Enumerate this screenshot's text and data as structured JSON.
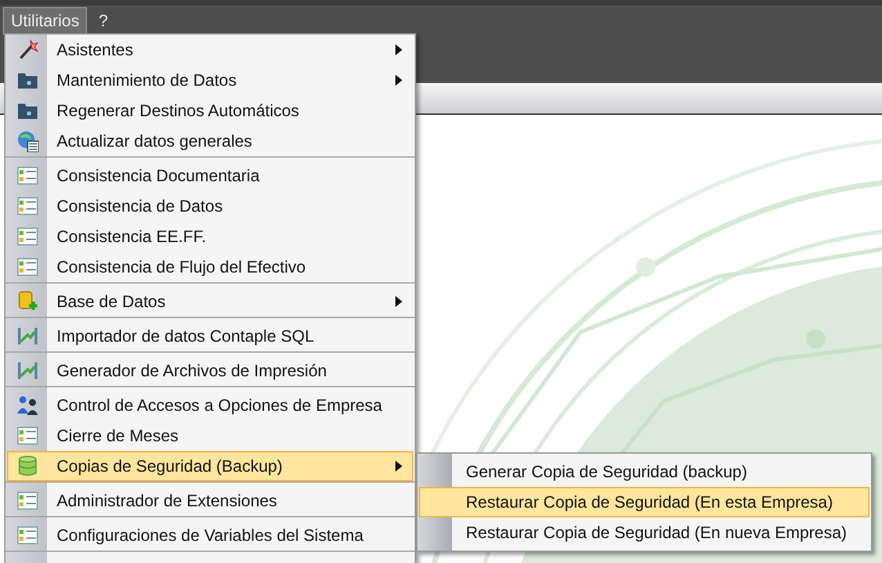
{
  "menubar": [
    {
      "label": "Utilitarios",
      "selected": true
    },
    {
      "label": "?",
      "selected": false
    }
  ],
  "menu": {
    "groups": [
      [
        {
          "label": "Asistentes",
          "kind": "wand",
          "has_submenu": true,
          "selected": false
        },
        {
          "label": "Mantenimiento de Datos",
          "kind": "folder",
          "has_submenu": true,
          "selected": false
        },
        {
          "label": "Regenerar Destinos Automáticos",
          "kind": "folder",
          "has_submenu": false,
          "selected": false
        },
        {
          "label": "Actualizar datos generales",
          "kind": "globe",
          "has_submenu": false,
          "selected": false
        }
      ],
      [
        {
          "label": "Consistencia Documentaria",
          "kind": "list",
          "has_submenu": false,
          "selected": false
        },
        {
          "label": "Consistencia de Datos",
          "kind": "list",
          "has_submenu": false,
          "selected": false
        },
        {
          "label": "Consistencia EE.FF.",
          "kind": "list",
          "has_submenu": false,
          "selected": false
        },
        {
          "label": "Consistencia de Flujo del Efectivo",
          "kind": "list",
          "has_submenu": false,
          "selected": false
        }
      ],
      [
        {
          "label": "Base de Datos",
          "kind": "dbplus",
          "has_submenu": true,
          "selected": false
        }
      ],
      [
        {
          "label": "Importador de datos Contaple SQL",
          "kind": "chart",
          "has_submenu": false,
          "selected": false
        }
      ],
      [
        {
          "label": "Generador de Archivos de Impresión",
          "kind": "chart",
          "has_submenu": false,
          "selected": false
        }
      ],
      [
        {
          "label": "Control de Accesos a Opciones de Empresa",
          "kind": "users",
          "has_submenu": false,
          "selected": false
        },
        {
          "label": "Cierre de Meses",
          "kind": "list",
          "has_submenu": false,
          "selected": false
        },
        {
          "label": "Copias de Seguridad (Backup)",
          "kind": "database",
          "has_submenu": true,
          "selected": true
        }
      ],
      [
        {
          "label": "Administrador de Extensiones",
          "kind": "list",
          "has_submenu": false,
          "selected": false
        }
      ],
      [
        {
          "label": "Configuraciones de Variables del Sistema",
          "kind": "list",
          "has_submenu": false,
          "selected": false
        }
      ]
    ]
  },
  "submenu": {
    "items": [
      {
        "label": "Generar Copia de Seguridad (backup)",
        "selected": false
      },
      {
        "label": "Restaurar Copia de Seguridad (En esta Empresa)",
        "selected": true
      },
      {
        "label": "Restaurar Copia de Seguridad (En nueva Empresa)",
        "selected": false
      }
    ]
  }
}
